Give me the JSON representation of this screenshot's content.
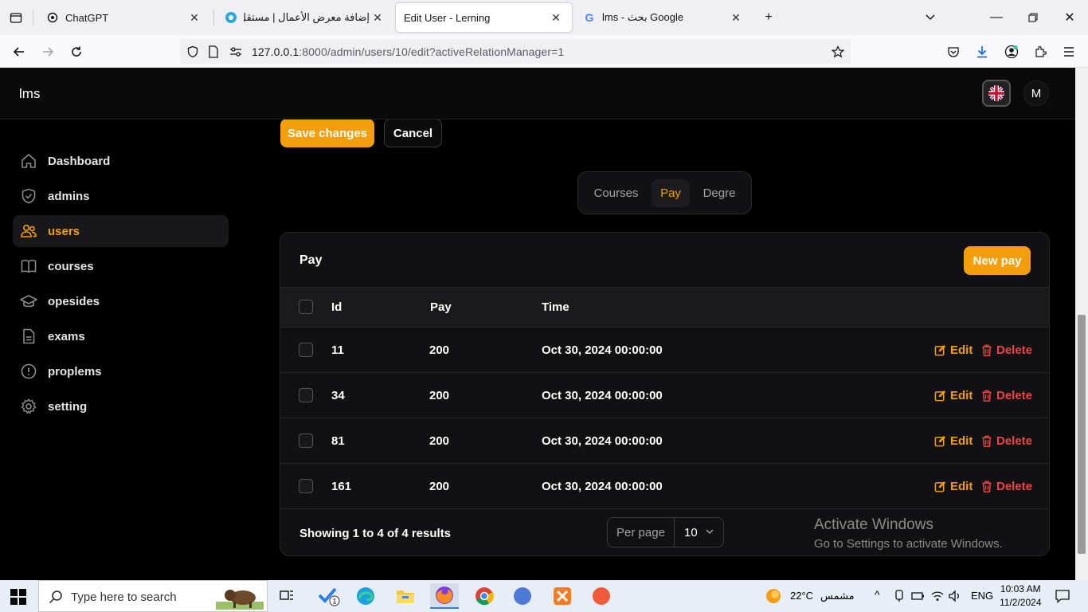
{
  "browser": {
    "tabs": [
      {
        "title": "ChatGPT",
        "icon": "chatgpt-icon"
      },
      {
        "title": "إضافة معرض الأعمال | مستقل",
        "icon": "mostaql-icon"
      },
      {
        "title": "Edit User - Lerning",
        "icon": "none"
      },
      {
        "title": "lms - بحث Google",
        "icon": "google-icon"
      }
    ],
    "url_host": "127.0.0.1",
    "url_path": ":8000/admin/users/10/edit?activeRelationManager=1"
  },
  "app": {
    "brand": "lms",
    "avatar_initial": "M",
    "sidebar": [
      {
        "label": "Dashboard",
        "icon": "home-icon"
      },
      {
        "label": "admins",
        "icon": "shield-icon"
      },
      {
        "label": "users",
        "icon": "users-icon"
      },
      {
        "label": "courses",
        "icon": "book-icon"
      },
      {
        "label": "opesides",
        "icon": "graduation-cap-icon"
      },
      {
        "label": "exams",
        "icon": "document-icon"
      },
      {
        "label": "proplems",
        "icon": "alert-circle-icon"
      },
      {
        "label": "setting",
        "icon": "gear-icon"
      }
    ],
    "active_sidebar": "users",
    "save_label": "Save changes",
    "cancel_label": "Cancel",
    "relation_tabs": [
      "Courses",
      "Pay",
      "Degre"
    ],
    "active_relation_tab": "Pay",
    "table": {
      "title": "Pay",
      "new_label": "New pay",
      "columns": [
        "Id",
        "Pay",
        "Time"
      ],
      "rows": [
        {
          "id": "11",
          "pay": "200",
          "time": "Oct 30, 2024 00:00:00"
        },
        {
          "id": "34",
          "pay": "200",
          "time": "Oct 30, 2024 00:00:00"
        },
        {
          "id": "81",
          "pay": "200",
          "time": "Oct 30, 2024 00:00:00"
        },
        {
          "id": "161",
          "pay": "200",
          "time": "Oct 30, 2024 00:00:00"
        }
      ],
      "edit_label": "Edit",
      "delete_label": "Delete",
      "showing": "Showing 1 to 4 of 4 results",
      "per_page_label": "Per page",
      "per_page_value": "10"
    },
    "accent_color": "#f59e0b",
    "danger_color": "#ef4444"
  },
  "os": {
    "watermark_line1": "Activate Windows",
    "watermark_line2": "Go to Settings to activate Windows.",
    "search_placeholder": "Type here to search",
    "weather_temp": "22°C",
    "weather_text": "مشمس",
    "lang": "ENG",
    "time": "10:03 AM",
    "date": "11/2/2024",
    "badge_count": "1"
  }
}
